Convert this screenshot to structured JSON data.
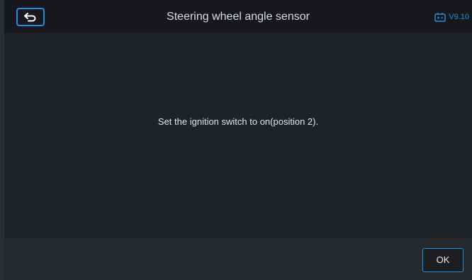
{
  "header": {
    "title": "Steering wheel angle sensor",
    "version": "V9.10",
    "back_icon": "back-arrow-icon",
    "battery_icon": "battery-icon"
  },
  "main": {
    "message": "Set the ignition switch to on(position 2)."
  },
  "footer": {
    "ok_label": "OK"
  },
  "colors": {
    "accent": "#1e8fe0",
    "background": "#1f2226",
    "header_bg": "#16181b",
    "footer_bg": "#26292d"
  }
}
